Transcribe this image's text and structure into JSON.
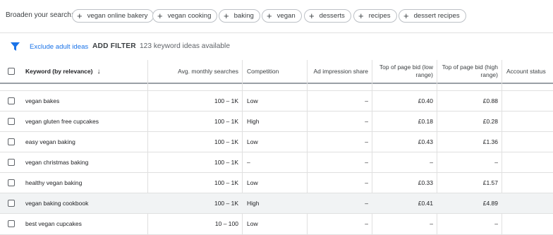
{
  "broaden": {
    "label": "Broaden your search:",
    "chips": [
      {
        "label": "vegan online bakery"
      },
      {
        "label": "vegan cooking"
      },
      {
        "label": "baking"
      },
      {
        "label": "vegan"
      },
      {
        "label": "desserts"
      },
      {
        "label": "recipes"
      },
      {
        "label": "dessert recipes"
      }
    ]
  },
  "filterbar": {
    "exclude_label": "Exclude adult ideas",
    "add_filter_label": "ADD FILTER",
    "count_text": "123 keyword ideas available"
  },
  "table": {
    "headers": {
      "keyword": "Keyword (by relevance)",
      "sort_arrow": "↓",
      "searches": "Avg. monthly searches",
      "competition": "Competition",
      "ad_share": "Ad impression share",
      "bid_low": "Top of page bid (low range)",
      "bid_high": "Top of page bid (high range)",
      "account_status": "Account status"
    },
    "rows": [
      {
        "keyword": "vegan bakes",
        "searches": "100 – 1K",
        "competition": "Low",
        "ad_share": "–",
        "bid_low": "£0.40",
        "bid_high": "£0.88",
        "highlight": false
      },
      {
        "keyword": "vegan gluten free cupcakes",
        "searches": "100 – 1K",
        "competition": "High",
        "ad_share": "–",
        "bid_low": "£0.18",
        "bid_high": "£0.28",
        "highlight": false
      },
      {
        "keyword": "easy vegan baking",
        "searches": "100 – 1K",
        "competition": "Low",
        "ad_share": "–",
        "bid_low": "£0.43",
        "bid_high": "£1.36",
        "highlight": false
      },
      {
        "keyword": "vegan christmas baking",
        "searches": "100 – 1K",
        "competition": "–",
        "ad_share": "–",
        "bid_low": "–",
        "bid_high": "–",
        "highlight": false
      },
      {
        "keyword": "healthy vegan baking",
        "searches": "100 – 1K",
        "competition": "Low",
        "ad_share": "–",
        "bid_low": "£0.33",
        "bid_high": "£1.57",
        "highlight": false
      },
      {
        "keyword": "vegan baking cookbook",
        "searches": "100 – 1K",
        "competition": "High",
        "ad_share": "–",
        "bid_low": "£0.41",
        "bid_high": "£4.89",
        "highlight": true
      },
      {
        "keyword": "best vegan cupcakes",
        "searches": "10 – 100",
        "competition": "Low",
        "ad_share": "–",
        "bid_low": "–",
        "bid_high": "–",
        "highlight": false
      }
    ]
  },
  "colors": {
    "accent": "#1a73e8",
    "border": "#e0e0e0",
    "highlight_row": "#f1f3f4"
  },
  "icons": {
    "filter": "filter-icon",
    "chip_add": "plus-icon",
    "checkbox": "checkbox-icon"
  }
}
